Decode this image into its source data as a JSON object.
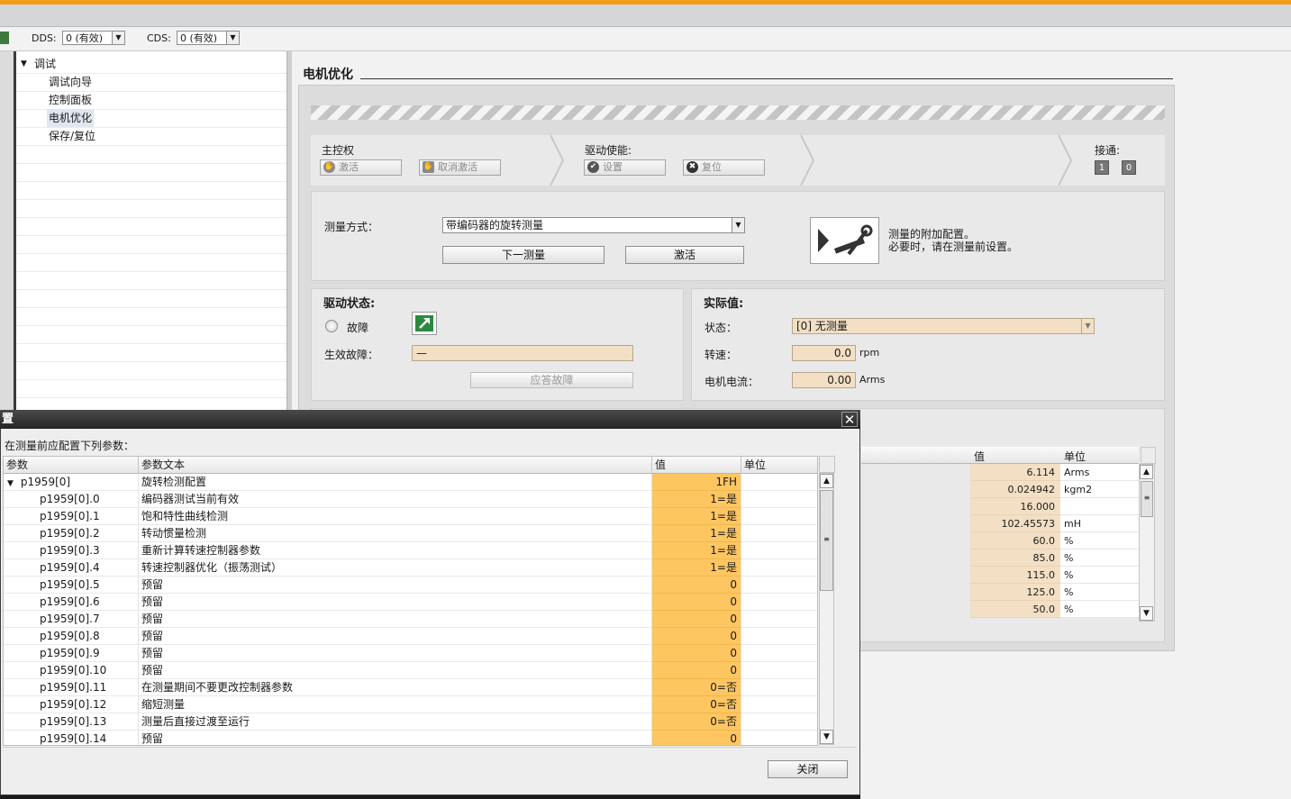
{
  "toolbar": {
    "dds_label": "DDS:",
    "dds_value": "0 (有效)",
    "cds_label": "CDS:",
    "cds_value": "0 (有效)"
  },
  "tree": {
    "root": "调试",
    "items": [
      "调试向导",
      "控制面板",
      "电机优化",
      "保存/复位"
    ]
  },
  "section": {
    "title": "电机优化"
  },
  "control": {
    "master_label": "主控权",
    "activate": "激活",
    "deactivate": "取消激活",
    "enable_label": "驱动使能:",
    "set": "设置",
    "reset": "复位",
    "connect_label": "接通:",
    "on": "1",
    "off": "0"
  },
  "measure": {
    "label": "测量方式：",
    "value": "带编码器的旋转测量",
    "next": "下一测量",
    "activate": "激活",
    "note1": "测量的附加配置。",
    "note2": "必要时，请在测量前设置。"
  },
  "drive_state": {
    "title": "驱动状态:",
    "fault": "故障",
    "active_fault_label": "生效故障：",
    "active_fault_value": "—",
    "ack": "应答故障"
  },
  "actual": {
    "title": "实际值:",
    "status_label": "状态：",
    "status_value": "[0] 无测量",
    "speed_label": "转速：",
    "speed_value": "0.0",
    "speed_unit": "rpm",
    "current_label": "电机电流：",
    "current_value": "0.00",
    "current_unit": "Arms"
  },
  "bg_table": {
    "col_value": "值",
    "col_unit": "单位",
    "rows": [
      {
        "value": "6.114",
        "unit": "Arms"
      },
      {
        "value": "0.024942",
        "unit": "kgm2"
      },
      {
        "value": "16.000",
        "unit": ""
      },
      {
        "value": "102.45573",
        "unit": "mH"
      },
      {
        "value": "60.0",
        "unit": "%"
      },
      {
        "value": "85.0",
        "unit": "%"
      },
      {
        "value": "115.0",
        "unit": "%"
      },
      {
        "value": "125.0",
        "unit": "%"
      },
      {
        "value": "50.0",
        "unit": "%"
      }
    ]
  },
  "dialog": {
    "title": "置",
    "info": "在测量前应配置下列参数：",
    "col_param": "参数",
    "col_text": "参数文本",
    "col_value": "值",
    "col_unit": "单位",
    "close": "关闭",
    "rows": [
      {
        "param": "p1959[0]",
        "text": "旋转检测配置",
        "value": "1FH",
        "group": true
      },
      {
        "param": "p1959[0].0",
        "text": "编码器测试当前有效",
        "value": "1=是"
      },
      {
        "param": "p1959[0].1",
        "text": "饱和特性曲线检测",
        "value": "1=是"
      },
      {
        "param": "p1959[0].2",
        "text": "转动惯量检测",
        "value": "1=是"
      },
      {
        "param": "p1959[0].3",
        "text": "重新计算转速控制器参数",
        "value": "1=是"
      },
      {
        "param": "p1959[0].4",
        "text": "转速控制器优化（振荡测试）",
        "value": "1=是"
      },
      {
        "param": "p1959[0].5",
        "text": "预留",
        "value": "0"
      },
      {
        "param": "p1959[0].6",
        "text": "预留",
        "value": "0"
      },
      {
        "param": "p1959[0].7",
        "text": "预留",
        "value": "0"
      },
      {
        "param": "p1959[0].8",
        "text": "预留",
        "value": "0"
      },
      {
        "param": "p1959[0].9",
        "text": "预留",
        "value": "0"
      },
      {
        "param": "p1959[0].10",
        "text": "预留",
        "value": "0"
      },
      {
        "param": "p1959[0].11",
        "text": "在测量期间不要更改控制器参数",
        "value": "0=否"
      },
      {
        "param": "p1959[0].12",
        "text": "缩短测量",
        "value": "0=否"
      },
      {
        "param": "p1959[0].13",
        "text": "测量后直接过渡至运行",
        "value": "0=否"
      },
      {
        "param": "p1959[0].14",
        "text": "预留",
        "value": "0"
      }
    ]
  },
  "colors": {
    "accent": "#f39c1a",
    "value_cell": "#fdc661",
    "readonly_field": "#f2dfc4"
  }
}
